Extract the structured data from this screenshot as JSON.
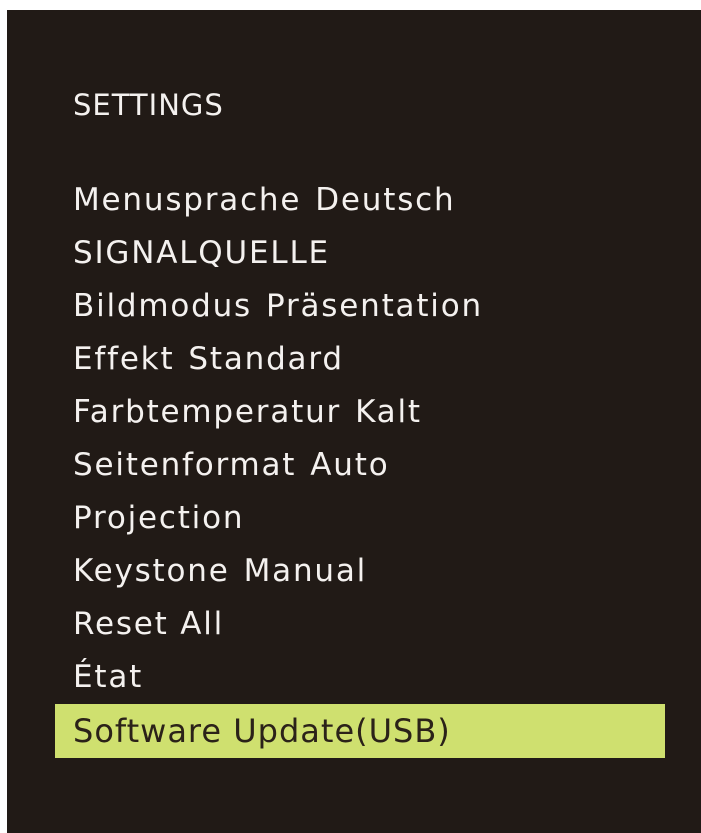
{
  "title": "SETTINGS",
  "colors": {
    "background": "#211a16",
    "text": "#f4f1ef",
    "highlight": "#cfe06f",
    "highlight_text": "#2b2219"
  },
  "menu": {
    "items": [
      {
        "label": "Menusprache",
        "value": "Deutsch",
        "selected": false
      },
      {
        "label": "SIGNALQUELLE",
        "value": "",
        "selected": false
      },
      {
        "label": "Bildmodus",
        "value": "Präsentation",
        "selected": false
      },
      {
        "label": "Effekt",
        "value": "Standard",
        "selected": false
      },
      {
        "label": "Farbtemperatur",
        "value": "Kalt",
        "selected": false
      },
      {
        "label": "Seitenformat",
        "value": "Auto",
        "selected": false
      },
      {
        "label": "Projection",
        "value": "",
        "selected": false
      },
      {
        "label": "Keystone",
        "value": "Manual",
        "selected": false
      },
      {
        "label": "Reset All",
        "value": "",
        "selected": false
      },
      {
        "label": "État",
        "value": "",
        "selected": false
      },
      {
        "label": "Software Update(USB)",
        "value": "",
        "selected": true
      }
    ]
  }
}
